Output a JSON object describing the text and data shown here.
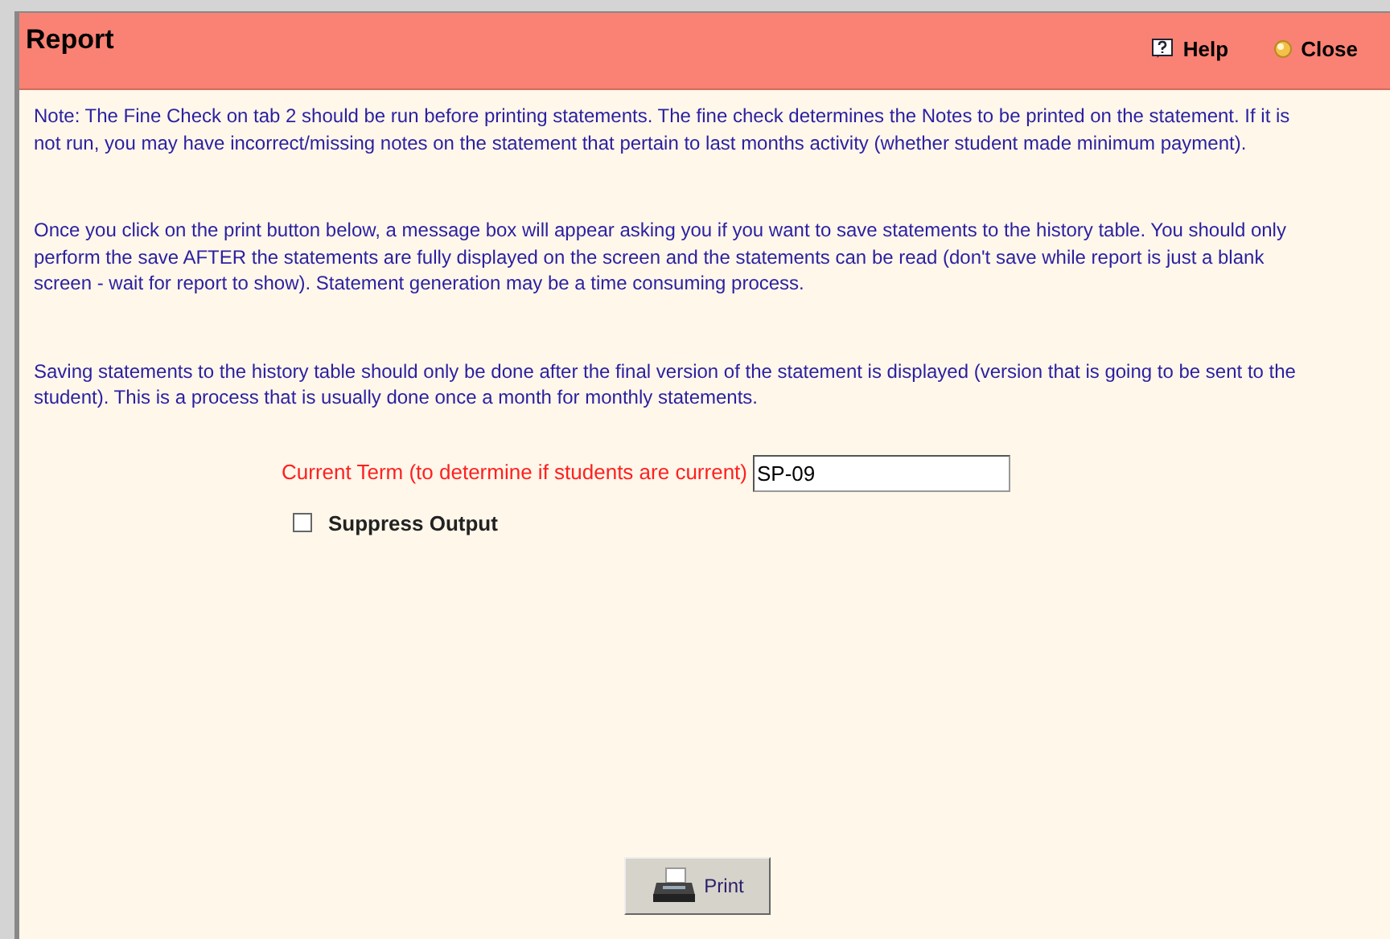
{
  "window": {
    "title": "Report"
  },
  "header_actions": [
    {
      "kind": "help",
      "label": "Help"
    },
    {
      "kind": "close",
      "label": "Close"
    }
  ],
  "notes": [
    "Note: The Fine Check on tab 2 should be run before printing statements. The fine check determines the Notes to be printed on the statement. If it is not run, you may have incorrect/missing notes on the statement that pertain to last months activity (whether student made minimum payment).",
    "Once you click on the print button below, a message box will appear asking you if you want to save statements to the history table. You should only perform the save AFTER the statements are fully displayed on the screen and the statements can be read (don't save while report is just a blank screen - wait for report to show). Statement generation may be a time consuming process.",
    "Saving statements to the history table should only be done after the final version of the statement is displayed (version that is going to be sent to the student). This is a process that is usually done once a month for monthly statements."
  ],
  "current_term": {
    "label": "Current Term (to determine if students are current)",
    "value": "SP-09"
  },
  "suppress_output": {
    "label": "Suppress Output",
    "checked": false
  },
  "print_button": {
    "label": "Print"
  }
}
